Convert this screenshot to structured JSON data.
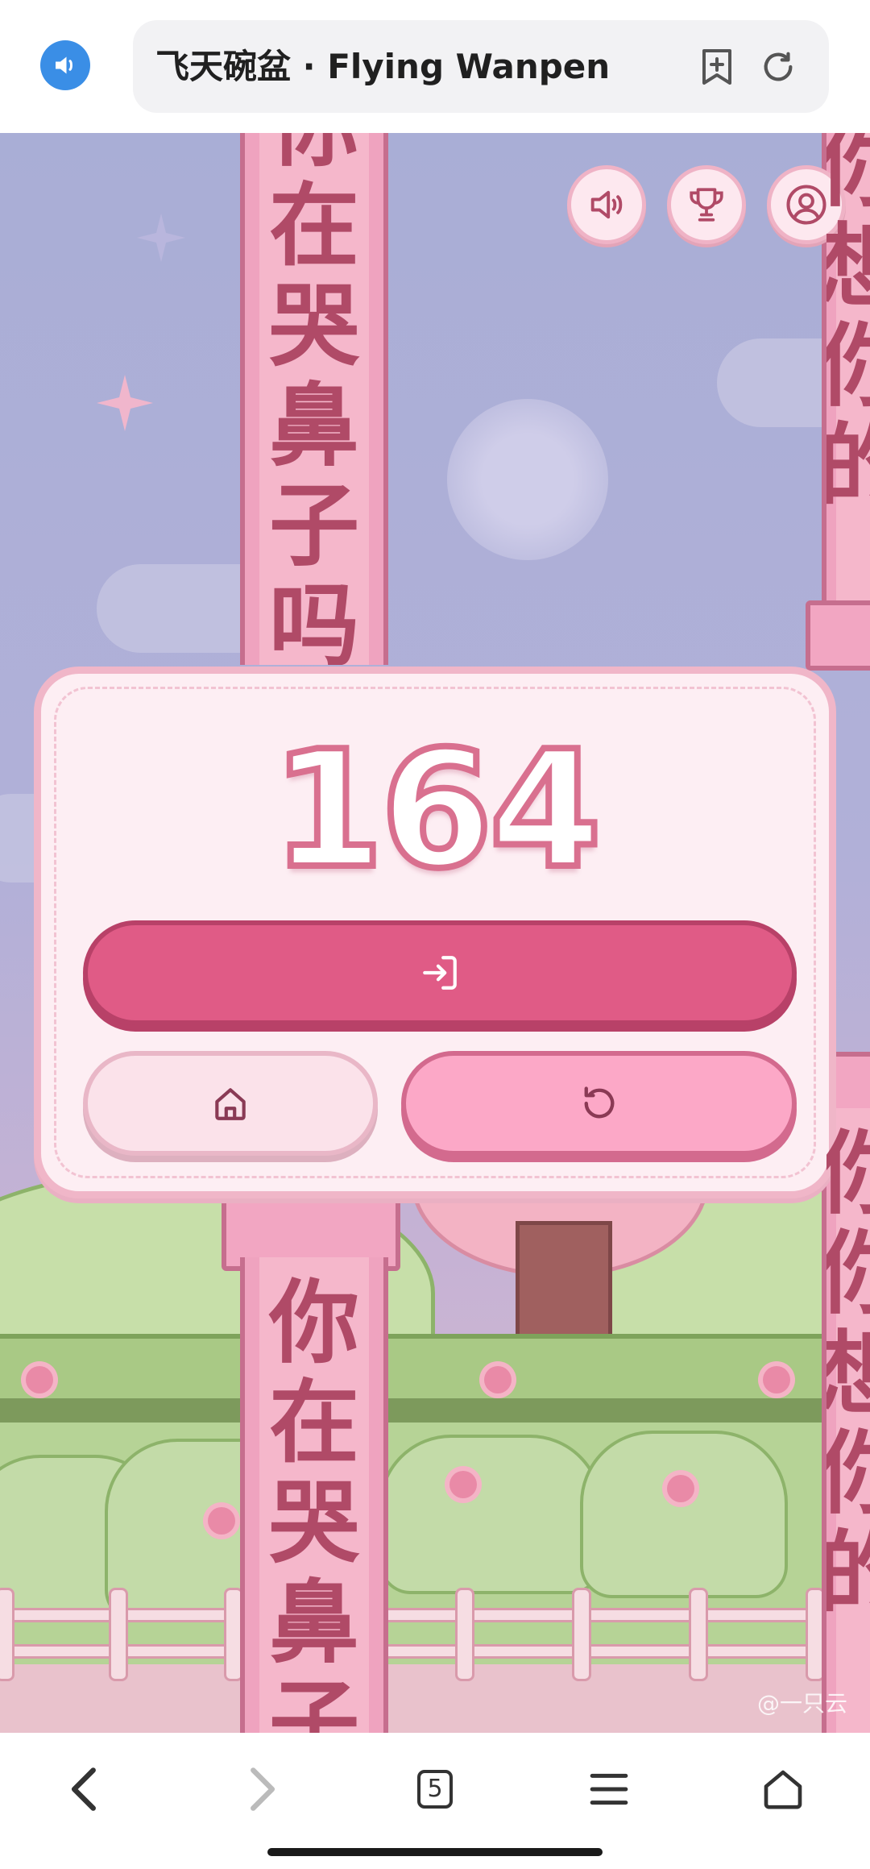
{
  "browser": {
    "page_title": "飞天碗盆 · Flying Wanpen",
    "tab_count": "5",
    "colors": {
      "accent": "#3a8ee6"
    },
    "icons": [
      "speaker-icon",
      "bookmark-add-icon",
      "refresh-icon",
      "back-icon",
      "forward-icon",
      "menu-icon",
      "home-icon"
    ]
  },
  "game": {
    "score": "164",
    "pillar_text_top_left": [
      "你",
      "在",
      "哭",
      "鼻",
      "子",
      "吗"
    ],
    "pillar_text_bottom_left": [
      "你",
      "在",
      "哭",
      "鼻",
      "子"
    ],
    "pillar_text_top_right": [
      "你",
      "想",
      "你",
      "的"
    ],
    "pillar_text_bottom_right": [
      "你",
      "你",
      "想",
      "你",
      "的"
    ],
    "watermark": "@一只云",
    "icons": [
      "volume-icon",
      "trophy-icon",
      "user-icon",
      "login-icon",
      "home-icon",
      "restart-icon"
    ],
    "colors": {
      "primary": "#e05b86",
      "secondary": "#fca8c7",
      "card": "#fdeef3",
      "pillar": "#efa3bf"
    }
  }
}
